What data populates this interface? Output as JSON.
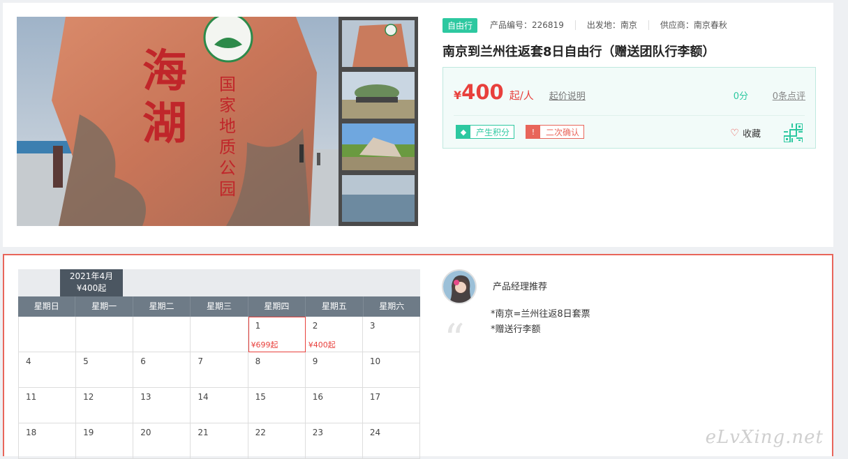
{
  "product": {
    "type_badge": "自由行",
    "meta": [
      "产品编号：226819",
      "出发地：南京",
      "供应商：南京春秋"
    ],
    "title": "南京到兰州往返套8日自由行（赠送团队行李额）",
    "price_symbol": "¥",
    "price": "400",
    "price_unit": "起/人",
    "price_note": "起价说明",
    "score": "0分",
    "reviews": "0条点评",
    "tags": [
      "产生积分",
      "二次确认"
    ],
    "favorite": "收藏"
  },
  "photo": {
    "stone_chars": [
      "海",
      "湖"
    ],
    "stone_vertical": [
      "国",
      "家",
      "地",
      "质",
      "公",
      "园"
    ]
  },
  "calendar": {
    "month": "2021年4月",
    "min_price": "¥400起",
    "weekdays": [
      "星期日",
      "星期一",
      "星期二",
      "星期三",
      "星期四",
      "星期五",
      "星期六"
    ],
    "weeks": [
      [
        {
          "d": ""
        },
        {
          "d": ""
        },
        {
          "d": ""
        },
        {
          "d": ""
        },
        {
          "d": "1",
          "p": "¥699起",
          "sel": true
        },
        {
          "d": "2",
          "p": "¥400起"
        },
        {
          "d": "3"
        }
      ],
      [
        {
          "d": "4"
        },
        {
          "d": "5"
        },
        {
          "d": "6"
        },
        {
          "d": "7"
        },
        {
          "d": "8"
        },
        {
          "d": "9"
        },
        {
          "d": "10"
        }
      ],
      [
        {
          "d": "11"
        },
        {
          "d": "12"
        },
        {
          "d": "13"
        },
        {
          "d": "14"
        },
        {
          "d": "15"
        },
        {
          "d": "16"
        },
        {
          "d": "17"
        }
      ],
      [
        {
          "d": "18"
        },
        {
          "d": "19"
        },
        {
          "d": "20"
        },
        {
          "d": "21"
        },
        {
          "d": "22"
        },
        {
          "d": "23"
        },
        {
          "d": "24"
        }
      ]
    ]
  },
  "manager": {
    "title": "产品经理推荐",
    "lines": [
      "*南京=兰州往返8日套票",
      "*赠送行李额"
    ]
  },
  "watermark": "eLvXing.net",
  "colors": {
    "accent": "#2dc8a0",
    "price": "#e8403c",
    "warn": "#e8655a"
  }
}
